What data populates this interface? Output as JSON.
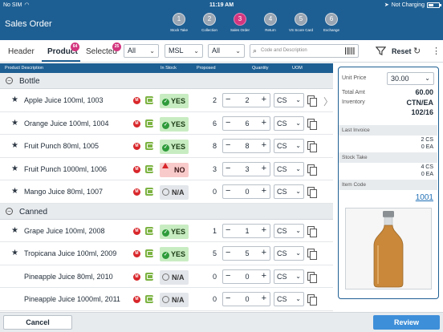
{
  "statusbar": {
    "carrier": "No SIM",
    "time": "11:19 AM",
    "charging": "Not Charging"
  },
  "header": {
    "title": "Sales Order",
    "steps": [
      {
        "num": "1",
        "label": "Stock Take",
        "active": false
      },
      {
        "num": "2",
        "label": "Collection",
        "active": false
      },
      {
        "num": "3",
        "label": "Sales Order",
        "active": true
      },
      {
        "num": "4",
        "label": "Return",
        "active": false
      },
      {
        "num": "5",
        "label": "VS Score Card",
        "active": false
      },
      {
        "num": "6",
        "label": "Exchange",
        "active": false
      }
    ]
  },
  "tabs": {
    "header_label": "Header",
    "product_label": "Product",
    "product_badge": "64",
    "selected_label": "Selected",
    "selected_badge": "25"
  },
  "filters": {
    "filter1": "All",
    "filter2": "MSL",
    "filter3": "All",
    "search_placeholder": "Code and Description",
    "reset_label": "Reset"
  },
  "columns": {
    "desc": "Product Description",
    "stock": "In Stock",
    "proposed": "Proposed",
    "quantity": "Quantity",
    "uom": "UOM"
  },
  "groups": [
    {
      "name": "Bottle",
      "items": [
        {
          "name": "Apple Juice 100ml, 1003",
          "starred": true,
          "stock": "YES",
          "stock_state": "yes",
          "proposed": "2",
          "qty": "2",
          "uom": "CS"
        },
        {
          "name": "Orange Juice 100ml, 1004",
          "starred": true,
          "stock": "YES",
          "stock_state": "yes",
          "proposed": "6",
          "qty": "6",
          "uom": "CS"
        },
        {
          "name": "Fruit Punch 80ml, 1005",
          "starred": true,
          "stock": "YES",
          "stock_state": "yes",
          "proposed": "8",
          "qty": "8",
          "uom": "CS"
        },
        {
          "name": "Fruit Punch 1000ml, 1006",
          "starred": true,
          "stock": "NO",
          "stock_state": "no",
          "proposed": "3",
          "qty": "3",
          "uom": "CS"
        },
        {
          "name": "Mango Juice 80ml, 1007",
          "starred": true,
          "stock": "N/A",
          "stock_state": "na",
          "proposed": "0",
          "qty": "0",
          "uom": "CS"
        }
      ]
    },
    {
      "name": "Canned",
      "items": [
        {
          "name": "Grape Juice 100ml, 2008",
          "starred": true,
          "stock": "YES",
          "stock_state": "yes",
          "proposed": "1",
          "qty": "1",
          "uom": "CS"
        },
        {
          "name": "Tropicana Juice 100ml, 2009",
          "starred": true,
          "stock": "YES",
          "stock_state": "yes",
          "proposed": "5",
          "qty": "5",
          "uom": "CS"
        },
        {
          "name": "Pineapple Juice 80ml, 2010",
          "starred": false,
          "stock": "N/A",
          "stock_state": "na",
          "proposed": "0",
          "qty": "0",
          "uom": "CS"
        },
        {
          "name": "Pineapple Juice 1000ml, 2011",
          "starred": false,
          "stock": "N/A",
          "stock_state": "na",
          "proposed": "0",
          "qty": "0",
          "uom": "CS"
        }
      ]
    }
  ],
  "details": {
    "unit_price_label": "Unit Price",
    "unit_price": "30.00",
    "total_amt_label": "Total Amt",
    "total_amt": "60.00",
    "inventory_label": "Inventory",
    "inventory_uom": "CTN/EA",
    "inventory_value": "102/16",
    "last_invoice_label": "Last Invoice",
    "last_invoice_cs": "2 CS",
    "last_invoice_ea": "0 EA",
    "stock_take_label": "Stock Take",
    "stock_take_cs": "4 CS",
    "stock_take_ea": "0 EA",
    "item_code_label": "Item Code",
    "item_code": "1001"
  },
  "footer": {
    "cancel_label": "Cancel",
    "review_label": "Review"
  }
}
